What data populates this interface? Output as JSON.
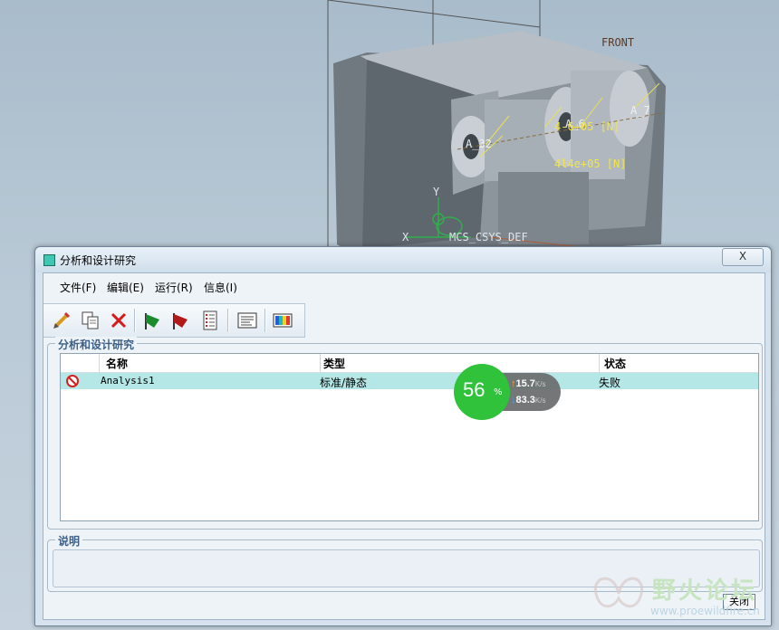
{
  "viewport": {
    "labels": {
      "front": "FRONT",
      "a7": "A_7",
      "a6": "A_6",
      "a32": "A_32",
      "force1": "4-6+05 [N]",
      "force2": "4l4e+05 [N]",
      "y_axis": "Y",
      "x_axis": "X",
      "csys": "MCS_CSYS_DEF"
    }
  },
  "dialog": {
    "title": "分析和设计研究",
    "close_glyph": "X",
    "menu": [
      {
        "label": "文件(F)"
      },
      {
        "label": "编辑(E)"
      },
      {
        "label": "运行(R)"
      },
      {
        "label": "信息(I)"
      }
    ],
    "toolbar_icons": [
      "pencil-icon",
      "copy-icon",
      "delete-icon",
      "green-flag-icon",
      "red-flag-icon",
      "list-icon",
      "report-icon",
      "results-icon"
    ],
    "studies_group": {
      "legend": "分析和设计研究",
      "columns": [
        "名称",
        "类型",
        "状态"
      ],
      "rows": [
        {
          "icon": "failed-icon",
          "name": "Analysis1",
          "type": "标准/静态",
          "status": "失败"
        }
      ]
    },
    "description_group": {
      "legend": "说明",
      "text": ""
    },
    "close_button": "关闭"
  },
  "network_monitor": {
    "percent": "56",
    "percent_sign": "%",
    "upload": "15.7",
    "download": "83.3",
    "unit": "K/s"
  },
  "watermark": {
    "text": "野火论坛",
    "url": "www.proewildfire.cn"
  },
  "colors": {
    "selected_row": "#b5e7e7",
    "net_green": "#2fc23a",
    "legend_blue": "#3d5f86"
  }
}
